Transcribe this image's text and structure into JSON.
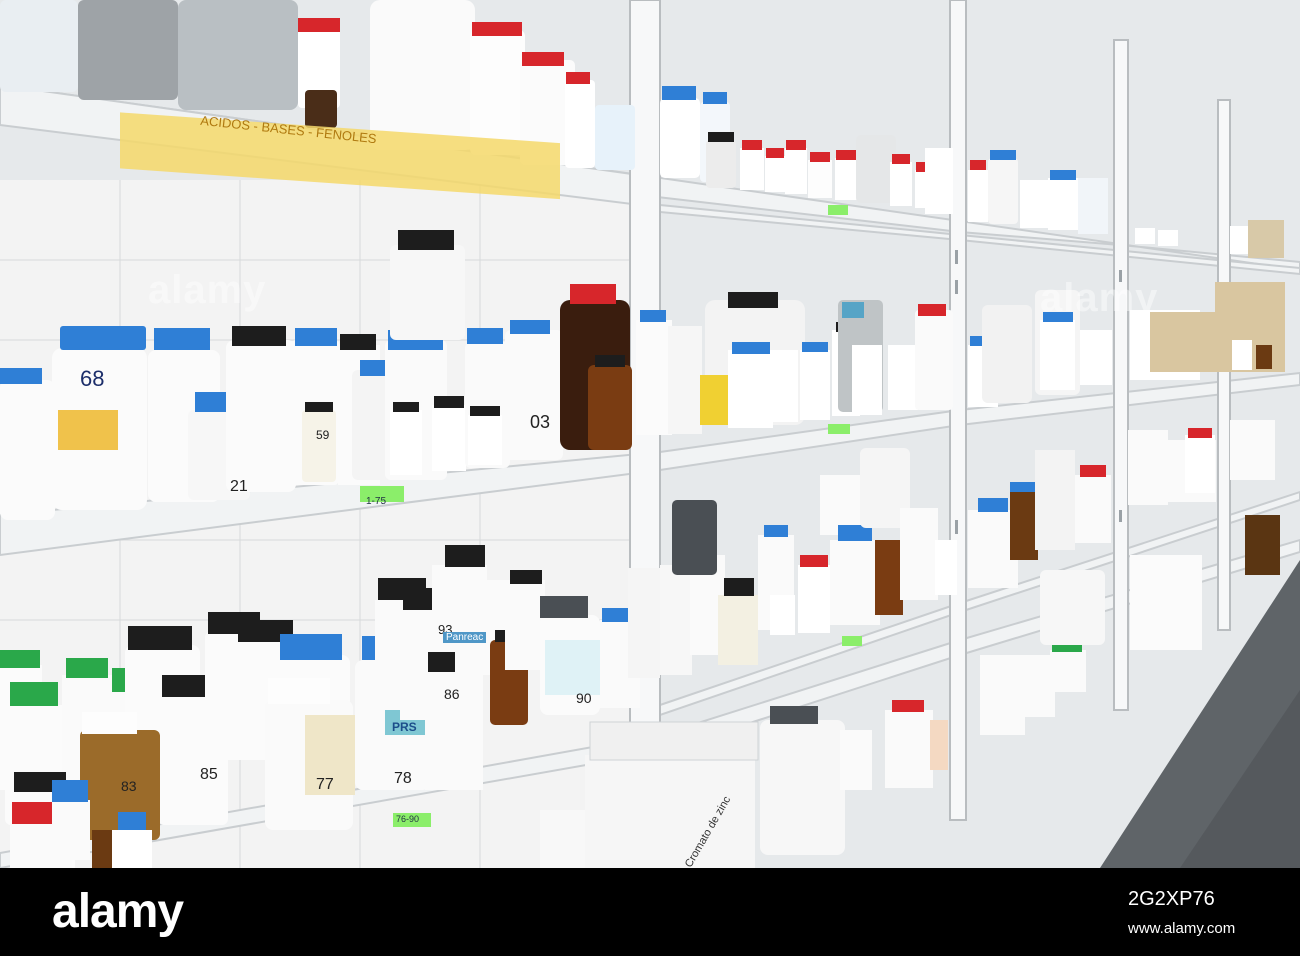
{
  "scene": {
    "description_tag": "laboratory-chemical-storage-shelves"
  },
  "labels": {
    "shelf_tag_top": "ACIDOS - BASES - FENOLES",
    "tag_1": "1-75",
    "tag_2": "76-90",
    "tag_3": "1-75",
    "jar_68": "68",
    "jar_59": "59",
    "jar_21": "21",
    "jar_03": "03",
    "jar_93": "93",
    "jar_86": "86",
    "jar_78": "78",
    "jar_77": "77",
    "jar_85": "85",
    "jar_83": "83",
    "jar_90": "90",
    "brand_prs": "PRS",
    "brand_panreac": "Panreac",
    "bucket_label": "Cromato de zinc"
  },
  "watermarks": {
    "main": "alamy",
    "second": "alamy"
  },
  "footer": {
    "logo": "alamy",
    "image_id": "2G2XP76",
    "site": "www.alamy.com"
  },
  "colors": {
    "cap_blue": "#2f7fd6",
    "cap_red": "#d7262b",
    "cap_green": "#2aa84a",
    "cap_black": "#1d1d1d",
    "shelf": "#f2f4f5",
    "tag_green": "#8bee6a"
  }
}
